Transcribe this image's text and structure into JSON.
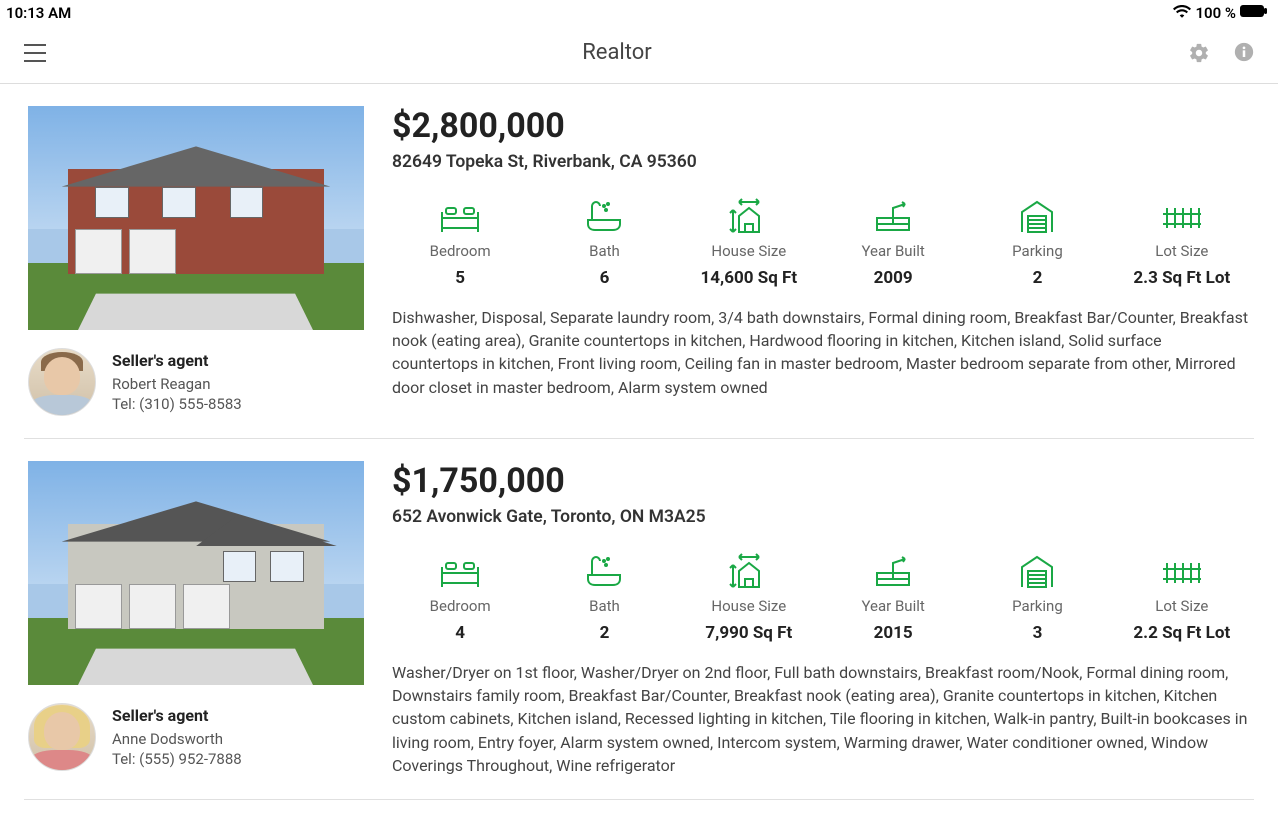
{
  "status_bar": {
    "time": "10:13 AM",
    "battery": "100 %"
  },
  "header": {
    "title": "Realtor"
  },
  "listings": [
    {
      "price": "$2,800,000",
      "address": "82649 Topeka St, Riverbank, CA 95360",
      "stats": {
        "bedroom": {
          "label": "Bedroom",
          "value": "5"
        },
        "bath": {
          "label": "Bath",
          "value": "6"
        },
        "house_size": {
          "label": "House Size",
          "value": "14,600 Sq Ft"
        },
        "year_built": {
          "label": "Year Built",
          "value": "2009"
        },
        "parking": {
          "label": "Parking",
          "value": "2"
        },
        "lot_size": {
          "label": "Lot Size",
          "value": "2.3 Sq Ft Lot"
        }
      },
      "description": "Dishwasher, Disposal, Separate laundry room, 3/4 bath downstairs, Formal dining room, Breakfast Bar/Counter, Breakfast nook (eating area), Granite countertops in kitchen, Hardwood flooring in kitchen, Kitchen island, Solid surface countertops in kitchen, Front living room, Ceiling fan in master bedroom, Master bedroom separate from other, Mirrored door closet in master bedroom, Alarm system owned",
      "agent": {
        "role": "Seller's agent",
        "name": "Robert Reagan",
        "tel": "Tel: (310) 555-8583"
      }
    },
    {
      "price": "$1,750,000",
      "address": "652 Avonwick Gate, Toronto, ON M3A25",
      "stats": {
        "bedroom": {
          "label": "Bedroom",
          "value": "4"
        },
        "bath": {
          "label": "Bath",
          "value": "2"
        },
        "house_size": {
          "label": "House Size",
          "value": "7,990 Sq Ft"
        },
        "year_built": {
          "label": "Year Built",
          "value": "2015"
        },
        "parking": {
          "label": "Parking",
          "value": "3"
        },
        "lot_size": {
          "label": "Lot Size",
          "value": "2.2 Sq Ft Lot"
        }
      },
      "description": "Washer/Dryer on 1st floor, Washer/Dryer on 2nd floor, Full bath downstairs, Breakfast room/Nook, Formal dining room, Downstairs family room, Breakfast Bar/Counter, Breakfast nook (eating area), Granite countertops in kitchen, Kitchen custom cabinets, Kitchen island, Recessed lighting in kitchen, Tile flooring in kitchen, Walk-in pantry, Built-in bookcases in living room, Entry foyer, Alarm system owned, Intercom system, Warming drawer, Water conditioner owned, Window Coverings Throughout, Wine refrigerator",
      "agent": {
        "role": "Seller's agent",
        "name": "Anne Dodsworth",
        "tel": "Tel: (555) 952-7888"
      }
    }
  ]
}
